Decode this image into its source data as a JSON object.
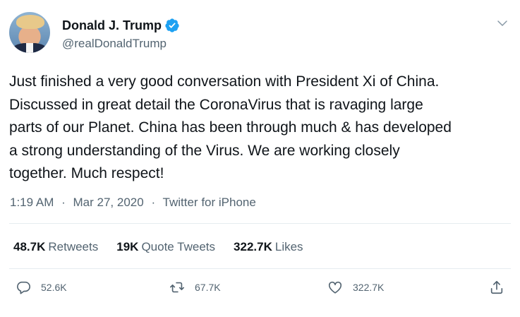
{
  "author": {
    "display_name": "Donald J. Trump",
    "handle": "@realDonaldTrump",
    "verified_icon": "verified-badge-icon",
    "accent_color": "#1da1f2"
  },
  "tweet": {
    "text": "Just finished a very good conversation with President Xi of China.\nDiscussed in great detail the CoronaVirus that is ravaging large\nparts of our Planet. China has been through much & has developed\na strong understanding of the Virus. We are working closely\ntogether. Much respect!",
    "time": "1:19 AM",
    "date": "Mar 27, 2020",
    "source": "Twitter for iPhone",
    "separator": "·"
  },
  "stats": {
    "retweets_count": "48.7K",
    "retweets_label": "Retweets",
    "quotes_count": "19K",
    "quotes_label": "Quote Tweets",
    "likes_count": "322.7K",
    "likes_label": "Likes"
  },
  "actions": {
    "reply_count": "52.6K",
    "retweet_count": "67.7K",
    "like_count": "322.7K",
    "icons": [
      "reply-icon",
      "retweet-icon",
      "like-icon",
      "share-icon"
    ]
  }
}
